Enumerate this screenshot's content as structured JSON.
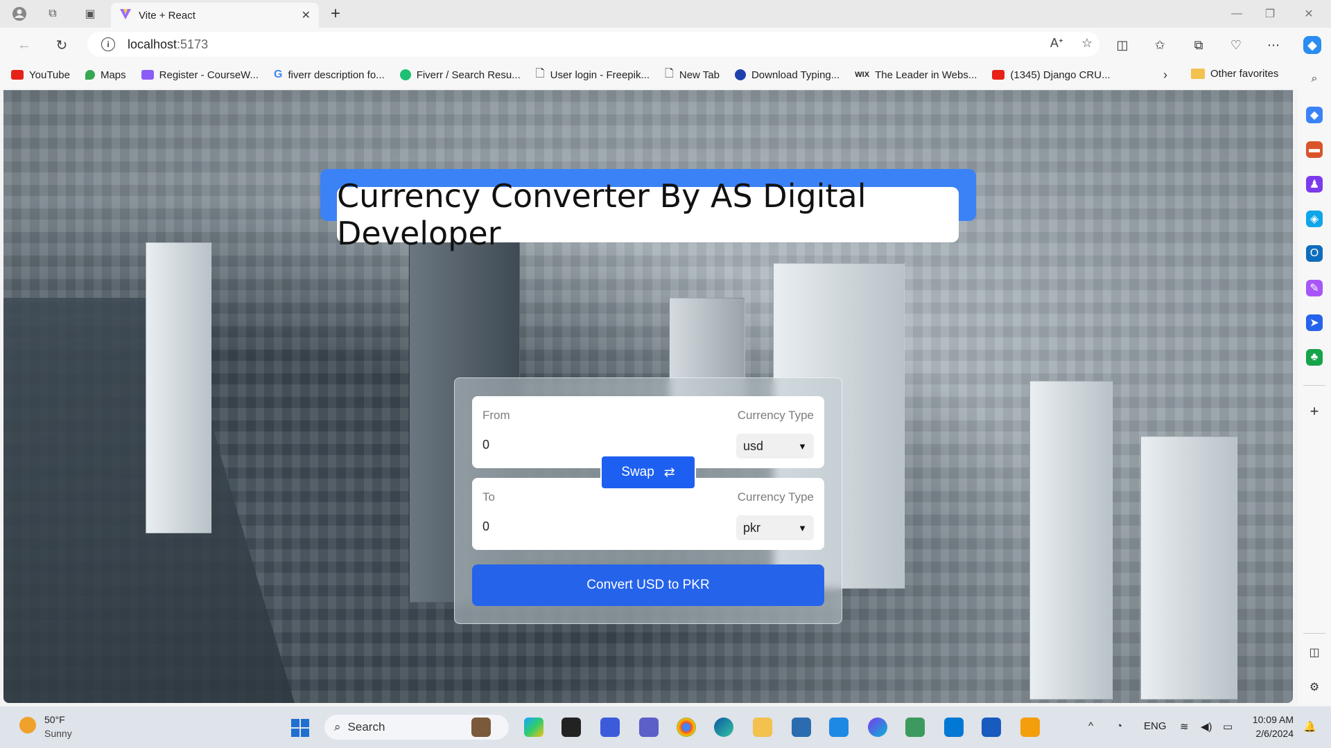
{
  "browser": {
    "tab_title": "Vite + React",
    "url_host": "localhost",
    "url_port": ":5173",
    "bookmarks": [
      {
        "label": "YouTube",
        "color": "#e62117"
      },
      {
        "label": "Maps",
        "color": "#34a853"
      },
      {
        "label": "Register - CourseW...",
        "color": "#8b5cf6"
      },
      {
        "label": "fiverr description fo...",
        "color": "#4285f4"
      },
      {
        "label": "Fiverr / Search Resu...",
        "color": "#1dbf73"
      },
      {
        "label": "User login - Freepik...",
        "color": "#999999"
      },
      {
        "label": "New Tab",
        "color": "#999999"
      },
      {
        "label": "Download Typing...",
        "color": "#1e40af"
      },
      {
        "label": "The Leader in Webs...",
        "color": "#222222"
      },
      {
        "label": "(1345) Django CRU...",
        "color": "#e62117"
      }
    ],
    "other_favorites": "Other favorites"
  },
  "app": {
    "title": "Currency Converter By AS Digital Developer",
    "from": {
      "label": "From",
      "value": "0",
      "type_label": "Currency Type",
      "currency": "usd"
    },
    "to": {
      "label": "To",
      "value": "0",
      "type_label": "Currency Type",
      "currency": "pkr"
    },
    "swap_label": "Swap",
    "swap_icon": "⇄",
    "convert_label": "Convert USD to PKR"
  },
  "taskbar": {
    "weather_temp": "50°F",
    "weather_cond": "Sunny",
    "search_placeholder": "Search",
    "lang": "ENG",
    "time": "10:09 AM",
    "date": "2/6/2024"
  }
}
